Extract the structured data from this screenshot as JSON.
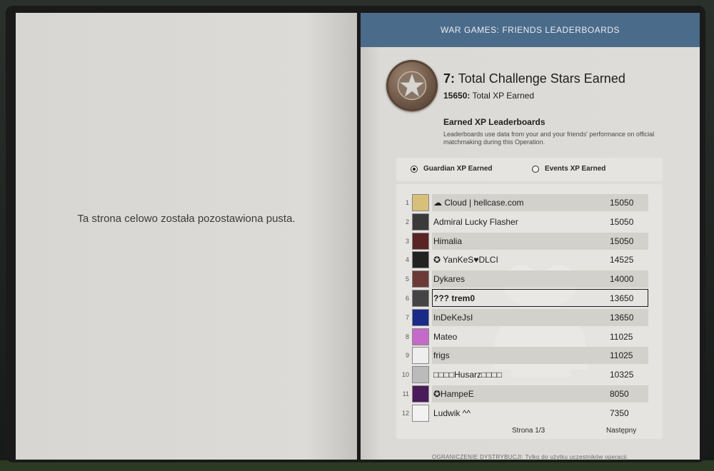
{
  "left_page": {
    "blank_text": "Ta strona celowo została pozostawiona pusta."
  },
  "header": {
    "title": "WAR GAMES: FRIENDS LEADERBOARDS"
  },
  "summary": {
    "stars_value": "7",
    "stars_label": "Total Challenge Stars Earned",
    "xp_value": "15650",
    "xp_label": "Total XP Earned"
  },
  "leaderboards": {
    "title": "Earned XP Leaderboards",
    "description": "Leaderboards use data from your and your friends' performance on official matchmaking during this Operation."
  },
  "filters": {
    "option1": "Guardian XP Earned",
    "option2": "Events XP Earned",
    "selected": "Guardian XP Earned"
  },
  "rows": [
    {
      "rank": "1",
      "name": "☁ Cloud | hellcase.com",
      "xp": "15050",
      "avatar_color": "#d9c07a"
    },
    {
      "rank": "2",
      "name": "Admiral Lucky Flasher",
      "xp": "15050",
      "avatar_color": "#3a3a3a"
    },
    {
      "rank": "3",
      "name": "Himalia",
      "xp": "15050",
      "avatar_color": "#5a2424"
    },
    {
      "rank": "4",
      "name": "✪ YanKeS♥DLCI",
      "xp": "14525",
      "avatar_color": "#222222"
    },
    {
      "rank": "5",
      "name": "Dykares",
      "xp": "14000",
      "avatar_color": "#6b3a36"
    },
    {
      "rank": "6",
      "name": "??? trem0",
      "xp": "13650",
      "avatar_color": "#444444"
    },
    {
      "rank": "7",
      "name": "InDeKeJsI",
      "xp": "13650",
      "avatar_color": "#1a2a88"
    },
    {
      "rank": "8",
      "name": "Mateo",
      "xp": "11025",
      "avatar_color": "#c46ac8"
    },
    {
      "rank": "9",
      "name": "frigs",
      "xp": "11025",
      "avatar_color": "#eeeeee"
    },
    {
      "rank": "10",
      "name": "□□□□Husarz□□□□",
      "xp": "10325",
      "avatar_color": "#bbbbbb"
    },
    {
      "rank": "11",
      "name": "✪HampeE",
      "xp": "8050",
      "avatar_color": "#4a1a5a"
    },
    {
      "rank": "12",
      "name": "Ludwik ^^",
      "xp": "7350",
      "avatar_color": "#f2f2f2"
    }
  ],
  "pager": {
    "page": "Strona 1/3",
    "next": "Następny"
  },
  "footer": {
    "text": "OGRANICZENIE DYSTRYBUCJI: Tylko do użytku uczestników operacji."
  }
}
